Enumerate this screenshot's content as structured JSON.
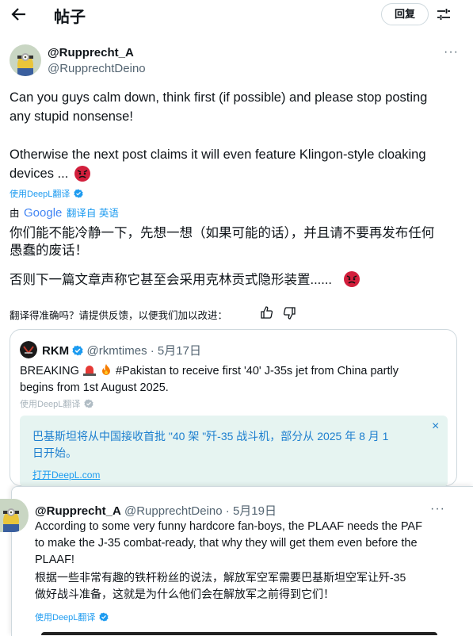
{
  "header": {
    "back_icon": "arrow-left-icon",
    "title": "帖子",
    "reply_button": "回复",
    "tune_icon": "tune-icon"
  },
  "main_post": {
    "display_name": "@Rupprecht_A",
    "handle": "@RupprechtDeino",
    "more": "···",
    "text_line1": "Can you guys calm down, think first (if possible) and please stop posting",
    "text_line2": "any stupid nonsense!",
    "text_line3": "Otherwise the next post claims it will even feature Klingon-style cloaking",
    "text_line4": "devices ...",
    "deepl_label": "使用DeepL翻译",
    "translated_by_prefix": "由",
    "google_logo": "Google",
    "translated_from": "翻译自 英语",
    "translation_line1": "你们能不能冷静一下，先想一想（如果可能的话），并且请不要再发布任何",
    "translation_line2": "愚蠢的废话！",
    "translation_line3": "否则下一篇文章声称它甚至会采用克林贡式隐形装置......",
    "feedback_prompt": "翻译得准确吗？请提供反馈，以便我们加以改进：",
    "thumbs_up_icon": "thumbs-up-icon",
    "thumbs_down_icon": "thumbs-down-icon"
  },
  "quote": {
    "display_name": "RKM",
    "handle": "@rkmtimes",
    "dot": "·",
    "date": "5月17日",
    "text_prefix": "BREAKING",
    "text_line1_rest": "#Pakistan to receive first '40' J-35s jet from China partly",
    "text_line2": "begins from 1st August 2025.",
    "deepl_label": "使用DeepL翻译",
    "deepl_translation_line1": "巴基斯坦将从中国接收首批 \"40 架 \"歼-35 战斗机，部分从 2025 年 8 月 1",
    "deepl_translation_line2": "日开始。",
    "open_deepl": "打开DeepL.com",
    "close": "×"
  },
  "reply": {
    "display_name": "@Rupprecht_A",
    "handle": "@RupprechtDeino",
    "dot": "·",
    "date": "5月19日",
    "more": "···",
    "text_line1": "According to some very funny hardcore fan-boys, the PLAAF needs the PAF",
    "text_line2": "to make the J-35 combat-ready, that why they will get them even before the",
    "text_line3": "PLAAF!",
    "translation_line1": "根据一些非常有趣的铁杆粉丝的说法，解放军空军需要巴基斯坦空军让歼-35",
    "translation_line2": "做好战斗准备，这就是为什么他们会在解放军之前得到它们！",
    "deepl_label": "使用DeepL翻译"
  },
  "colors": {
    "link": "#1d9bf0",
    "deepl_box": "#e6f4f1",
    "verified": "#1d9bf0",
    "angry": "#d21f3c"
  }
}
